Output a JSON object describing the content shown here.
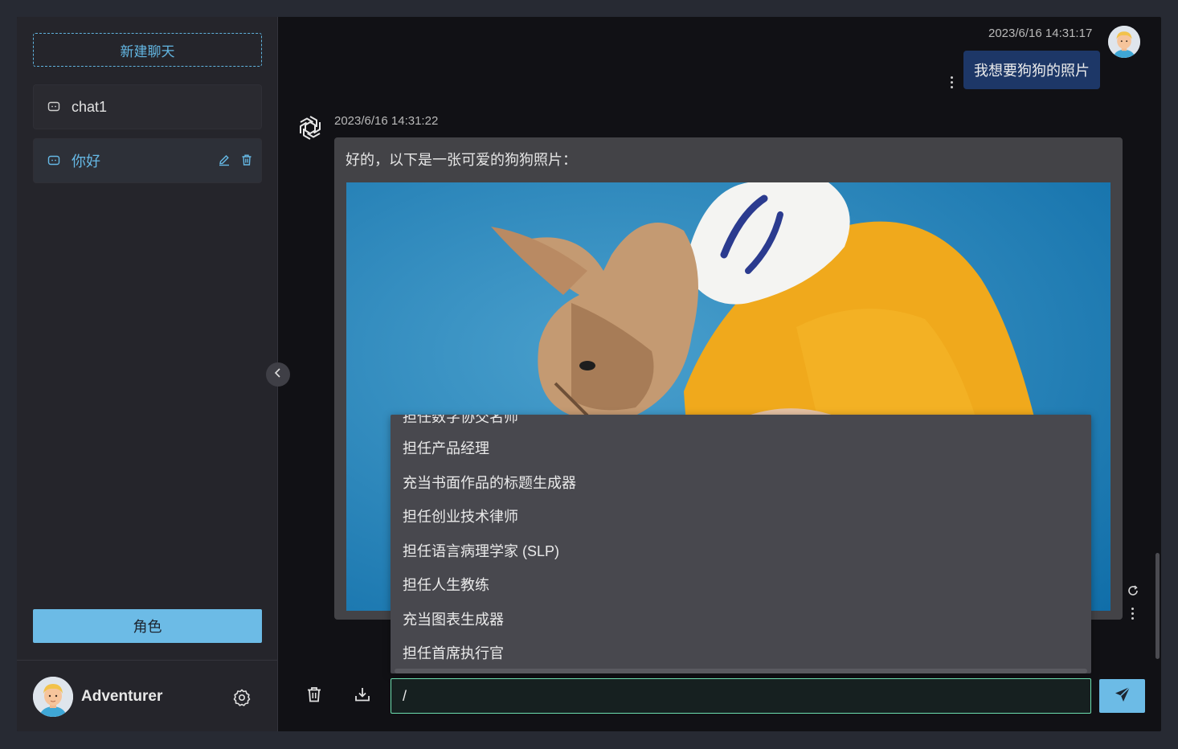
{
  "sidebar": {
    "new_chat_label": "新建聊天",
    "chats": [
      {
        "title": "chat1",
        "active": false
      },
      {
        "title": "你好",
        "active": true
      }
    ],
    "role_button_label": "角色",
    "user": {
      "name": "Adventurer"
    }
  },
  "messages": {
    "user": {
      "timestamp": "2023/6/16 14:31:17",
      "text": "我想要狗狗的照片"
    },
    "bot": {
      "timestamp": "2023/6/16 14:31:22",
      "text": "好的，以下是一张可爱的狗狗照片："
    }
  },
  "prompt_menu": {
    "partial_item": "担任数字协交名师",
    "items": [
      "担任产品经理",
      "充当书面作品的标题生成器",
      "担任创业技术律师",
      "担任语言病理学家 (SLP)",
      "担任人生教练",
      "充当图表生成器",
      "担任首席执行官"
    ]
  },
  "input": {
    "value": "/"
  },
  "colors": {
    "accent": "#6cbbe6",
    "user_bubble": "#1d3767",
    "input_border": "#6ee0b0"
  },
  "icons": {
    "chat_item": "chat-bubble-icon",
    "edit": "pencil-icon",
    "delete": "trash-icon",
    "settings": "gear-icon",
    "collapse": "chevron-left-icon",
    "clear": "trash-icon",
    "download": "download-icon",
    "send": "paper-plane-icon",
    "regenerate": "refresh-icon",
    "more": "more-vertical-icon",
    "bot_avatar": "openai-logo-icon"
  }
}
